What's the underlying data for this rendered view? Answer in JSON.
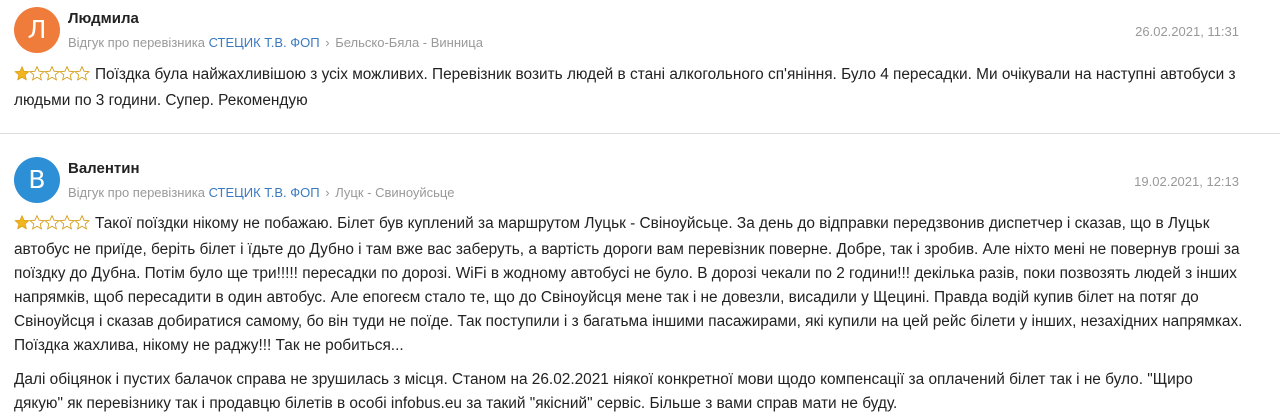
{
  "colors": {
    "avatar_1": "#f07c3b",
    "avatar_2": "#2d8fd6",
    "link": "#3a7bc0",
    "meta": "#999999",
    "star": "#f2b51f"
  },
  "reviews": [
    {
      "avatar_letter": "Л",
      "author": "Людмила",
      "meta_prefix": "Відгук про перевізника",
      "carrier": "СТЕЦИК Т.В. ФОП",
      "separator": "›",
      "route": "Бельско-Бяла - Винница",
      "date": "26.02.2021, 11:31",
      "rating": 1,
      "rating_max": 5,
      "paragraphs": [
        "Поїздка була найжахливішою з усіх можливих. Перевізник возить людей в стані алкогольного сп'яніння. Було 4 пересадки. Ми очікували на наступні автобуси з людьми по 3 години. Супер. Рекомендую"
      ]
    },
    {
      "avatar_letter": "В",
      "author": "Валентин",
      "meta_prefix": "Відгук про перевізника",
      "carrier": "СТЕЦИК Т.В. ФОП",
      "separator": "›",
      "route": "Луцк - Свиноуйсьце",
      "date": "19.02.2021, 12:13",
      "rating": 1,
      "rating_max": 5,
      "paragraphs": [
        "Такої поїздки нікому не побажаю. Білет був куплений за маршрутом Луцьк - Свіноуйсьце. За день до відправки передзвонив диспетчер і сказав, що в Луцьк автобус не приїде, беріть білет і їдьте до Дубно і там вже вас заберуть, а вартість дороги вам перевізник поверне. Добре, так і зробив. Але ніхто мені не повернув гроші за поїздку до Дубна. Потім було ще три!!!!! пересадки по дорозі. WiFi в жодному автобусі не було. В дорозі чекали по 2 години!!! декілька разів, поки позвозять людей з інших напрямків, щоб пересадити в один автобус. Але епогеєм стало те, що до Свіноуйсця мене так і не довезли, висадили у Щецині. Правда водій купив білет на потяг до Свіноуйсця і сказав добиратися самому, бо він туди не поїде. Так поступили і з багатьма іншими пасажирами, які купили на цей рейс білети у інших, незахідних напрямках. Поїздка жахлива, нікому не раджу!!! Так не робиться...",
        "Далі обіцянок і пустих балачок справа не зрушилась з місця. Станом на 26.02.2021 ніякої конкретної мови щодо компенсації за оплачений білет так і не було. \"Щиро дякую\" як перевізнику так і продавцю білетів в особі infobus.eu за такий \"якісний\" сервіс. Більше з вами справ мати не буду."
      ]
    }
  ]
}
